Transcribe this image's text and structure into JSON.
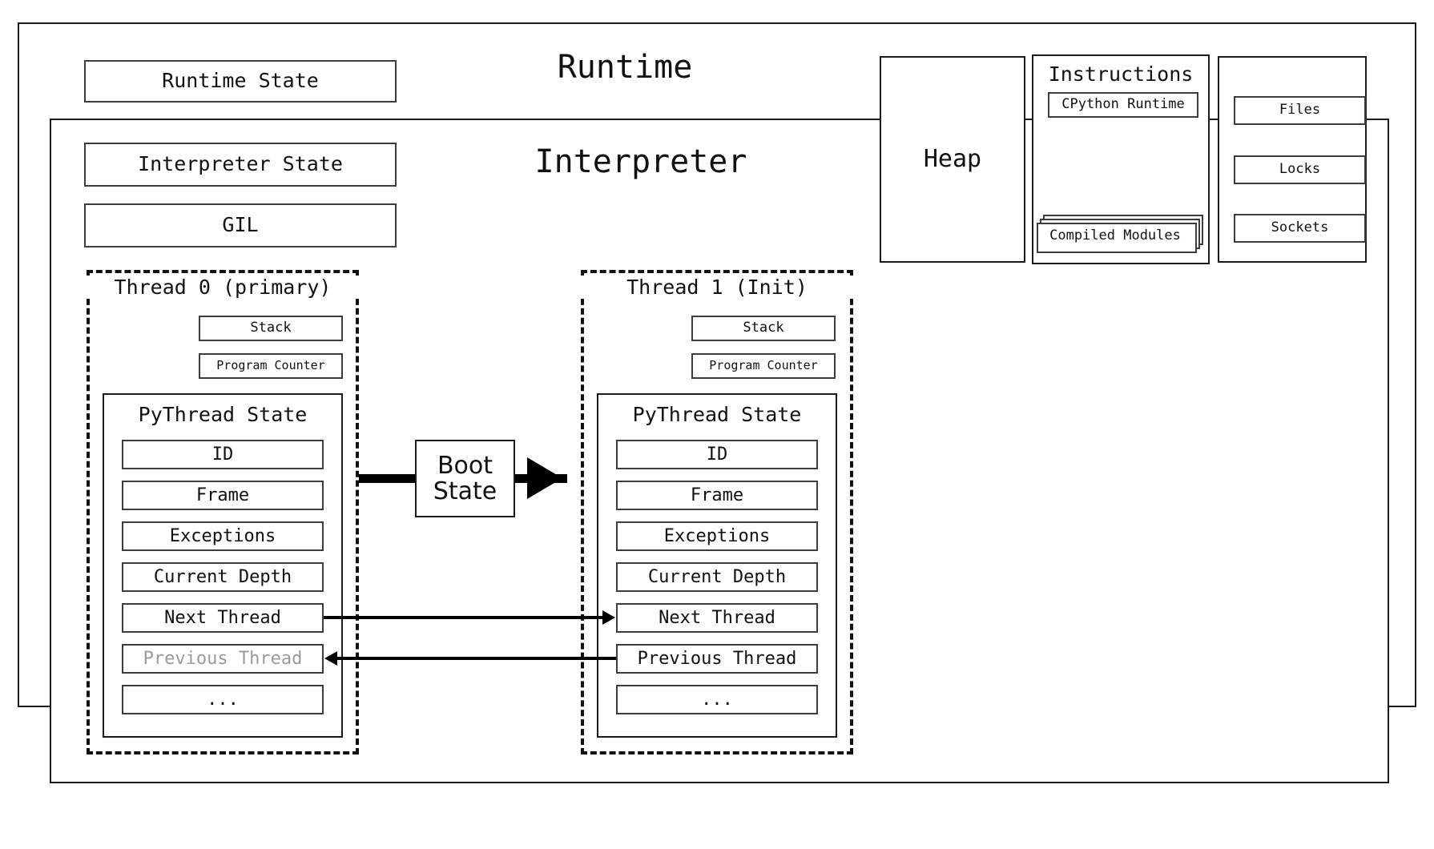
{
  "diagram": {
    "runtime_title": "Runtime",
    "interpreter_title": "Interpreter",
    "runtime_state_label": "Runtime State",
    "interpreter_state_label": "Interpreter State",
    "gil_label": "GIL",
    "heap_label": "Heap"
  },
  "instructions": {
    "title": "Instructions",
    "cpython_runtime_label": "CPython Runtime",
    "compiled_modules_label": "Compiled Modules"
  },
  "resources": {
    "files_label": "Files",
    "locks_label": "Locks",
    "sockets_label": "Sockets"
  },
  "boot": {
    "line1": "Boot",
    "line2": "State"
  },
  "threads": [
    {
      "title": "Thread 0 (primary)",
      "stack_label": "Stack",
      "program_counter_label": "Program Counter",
      "pythread_state_title": "PyThread State",
      "fields": [
        {
          "label": "ID",
          "muted": false
        },
        {
          "label": "Frame",
          "muted": false
        },
        {
          "label": "Exceptions",
          "muted": false
        },
        {
          "label": "Current Depth",
          "muted": false
        },
        {
          "label": "Next Thread",
          "muted": false
        },
        {
          "label": "Previous Thread",
          "muted": true
        },
        {
          "label": "...",
          "muted": false
        }
      ]
    },
    {
      "title": "Thread 1 (Init)",
      "stack_label": "Stack",
      "program_counter_label": "Program Counter",
      "pythread_state_title": "PyThread State",
      "fields": [
        {
          "label": "ID",
          "muted": false
        },
        {
          "label": "Frame",
          "muted": false
        },
        {
          "label": "Exceptions",
          "muted": false
        },
        {
          "label": "Current Depth",
          "muted": false
        },
        {
          "label": "Next Thread",
          "muted": false
        },
        {
          "label": "Previous Thread",
          "muted": false
        },
        {
          "label": "...",
          "muted": false
        }
      ]
    }
  ],
  "colors": {
    "stroke": "#1a1a1a",
    "stroke_light": "#3c3c3c",
    "muted_text": "#9a9a9a",
    "background": "#ffffff"
  }
}
